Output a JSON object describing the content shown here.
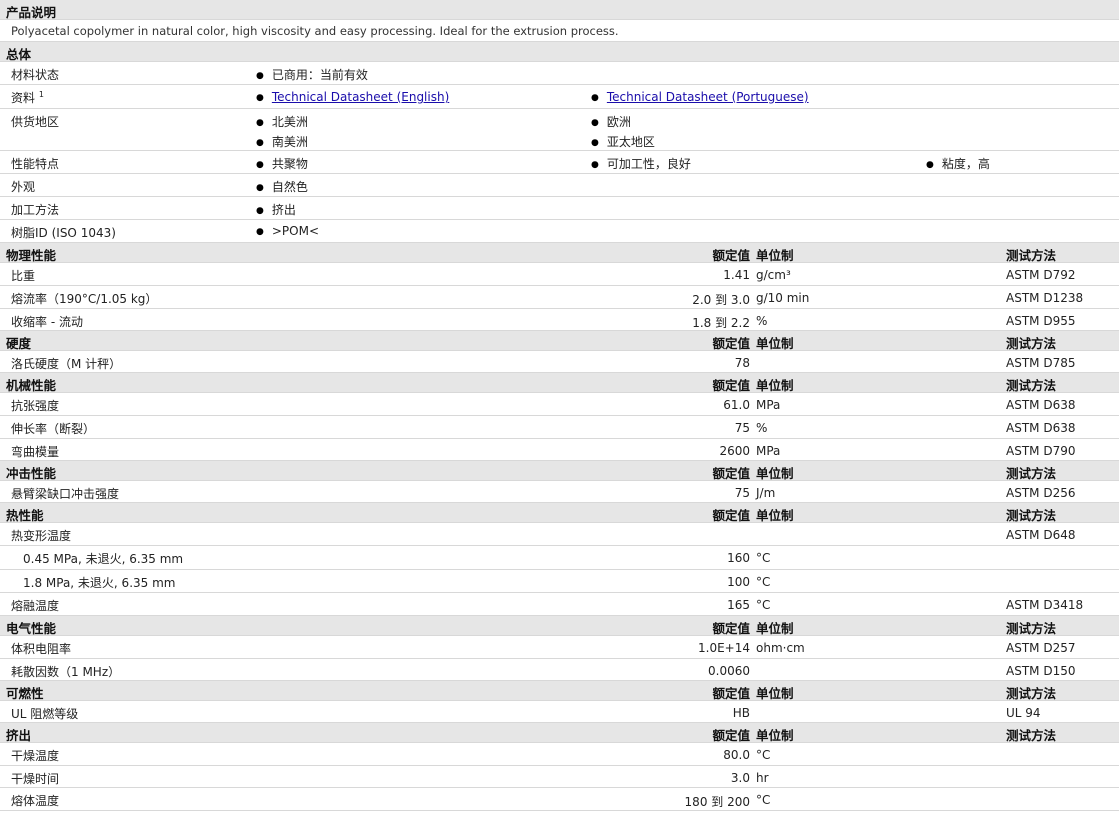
{
  "product": {
    "header": "产品说明",
    "text": "Polyacetal copolymer in natural color, high viscosity and easy processing. Ideal for the extrusion process."
  },
  "general": {
    "header": "总体",
    "rows": [
      {
        "label": "材料状态",
        "items": [
          "已商用：当前有效"
        ]
      },
      {
        "label": "资料",
        "sup": "1",
        "links": [
          "Technical Datasheet (English)",
          "Technical Datasheet (Portuguese)"
        ]
      },
      {
        "label": "供货地区",
        "items": [
          "北美洲",
          "欧洲",
          "南美洲",
          "亚太地区"
        ]
      },
      {
        "label": "性能特点",
        "items": [
          "共聚物",
          "可加工性，良好",
          "粘度，高"
        ]
      },
      {
        "label": "外观",
        "items": [
          "自然色"
        ]
      },
      {
        "label": "加工方法",
        "items": [
          "挤出"
        ]
      },
      {
        "label": "树脂ID (ISO 1043)",
        "items": [
          ">POM<"
        ]
      }
    ]
  },
  "columns": {
    "value": "额定值",
    "unit": "单位制",
    "method": "测试方法"
  },
  "sections": {
    "physical": {
      "header": "物理性能",
      "rows": [
        {
          "label": "比重",
          "value": "1.41",
          "unit": "g/cm³",
          "method": "ASTM D792"
        },
        {
          "label": "熔流率（190°C/1.05 kg）",
          "value": "2.0 到  3.0",
          "unit": "g/10 min",
          "method": "ASTM D1238"
        },
        {
          "label": "收缩率  - 流动",
          "value": "1.8 到  2.2",
          "unit": "%",
          "method": "ASTM D955"
        }
      ]
    },
    "hardness": {
      "header": "硬度",
      "rows": [
        {
          "label": "洛氏硬度（M 计秤）",
          "value": "78",
          "unit": "",
          "method": "ASTM D785"
        }
      ]
    },
    "mechanical": {
      "header": "机械性能",
      "rows": [
        {
          "label": "抗张强度",
          "value": "61.0",
          "unit": "MPa",
          "method": "ASTM D638"
        },
        {
          "label": "伸长率（断裂）",
          "value": "75",
          "unit": "%",
          "method": "ASTM D638"
        },
        {
          "label": "弯曲模量",
          "value": "2600",
          "unit": "MPa",
          "method": "ASTM D790"
        }
      ]
    },
    "impact": {
      "header": "冲击性能",
      "rows": [
        {
          "label": "悬臂梁缺口冲击强度",
          "value": "75",
          "unit": "J/m",
          "method": "ASTM D256"
        }
      ]
    },
    "thermal": {
      "header": "热性能",
      "rows": [
        {
          "label": "热变形温度",
          "value": "",
          "unit": "",
          "method": "ASTM D648"
        },
        {
          "label": "0.45 MPa, 未退火, 6.35 mm",
          "sub": true,
          "value": "160",
          "unit": "°C",
          "method": ""
        },
        {
          "label": "1.8 MPa, 未退火, 6.35 mm",
          "sub": true,
          "value": "100",
          "unit": "°C",
          "method": ""
        },
        {
          "label": "熔融温度",
          "value": "165",
          "unit": "°C",
          "method": "ASTM D3418"
        }
      ]
    },
    "electrical": {
      "header": "电气性能",
      "rows": [
        {
          "label": "体积电阻率",
          "value": "1.0E+14",
          "unit": "ohm·cm",
          "method": "ASTM D257"
        },
        {
          "label": "耗散因数（1 MHz）",
          "value": "0.0060",
          "unit": "",
          "method": "ASTM D150"
        }
      ]
    },
    "flammability": {
      "header": "可燃性",
      "rows": [
        {
          "label": "UL 阻燃等级",
          "value": "HB",
          "unit": "",
          "method": "UL 94"
        }
      ]
    },
    "extrusion": {
      "header": "挤出",
      "rows": [
        {
          "label": "干燥温度",
          "value": "80.0",
          "unit": "°C",
          "method": ""
        },
        {
          "label": "干燥时间",
          "value": "3.0",
          "unit": "hr",
          "method": ""
        },
        {
          "label": "熔体温度",
          "value": "180 到  200",
          "unit": "°C",
          "method": ""
        }
      ]
    }
  }
}
